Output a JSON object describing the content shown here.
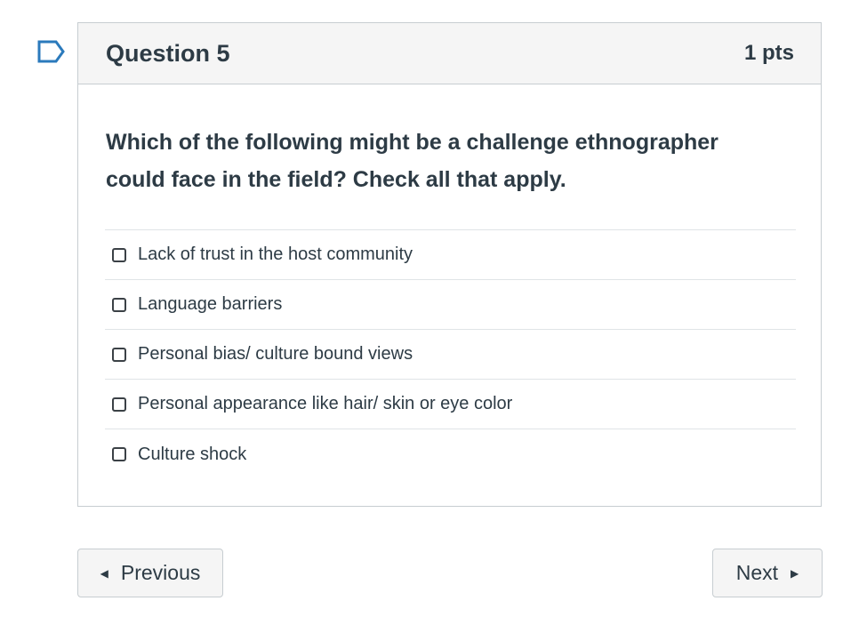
{
  "question": {
    "title": "Question 5",
    "points": "1 pts",
    "text": "Which of the following might be a challenge ethnographer could face in the field? Check all that apply.",
    "answers": [
      "Lack of trust in the host community",
      "Language barriers",
      "Personal bias/ culture bound views",
      "Personal appearance like hair/ skin or eye color",
      "Culture shock"
    ]
  },
  "navigation": {
    "previous_label": "Previous",
    "next_label": "Next"
  },
  "icons": {
    "flag": "flag-icon",
    "prev_arrow": "triangle-left-icon",
    "next_arrow": "triangle-right-icon"
  },
  "colors": {
    "flag": "#2b7abc",
    "text": "#2d3b45",
    "header_bg": "#f5f5f5",
    "border": "#c7cdd1"
  }
}
